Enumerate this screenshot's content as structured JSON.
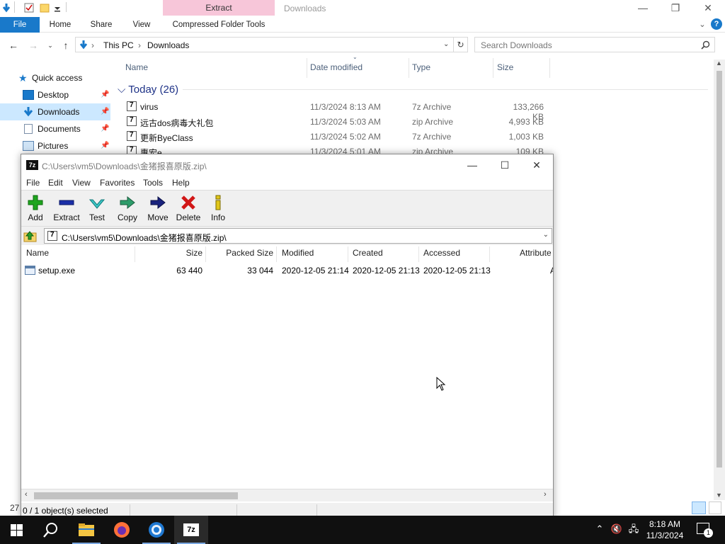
{
  "explorer": {
    "title": "Downloads",
    "context_tab": "Extract",
    "ribbon_tabs": [
      "File",
      "Home",
      "Share",
      "View",
      "Compressed Folder Tools"
    ],
    "breadcrumb": [
      "This PC",
      "Downloads"
    ],
    "search_placeholder": "Search Downloads",
    "sidebar": [
      {
        "label": "Quick access",
        "icon": "star-icon"
      },
      {
        "label": "Desktop",
        "icon": "desktop-icon"
      },
      {
        "label": "Downloads",
        "icon": "download-icon"
      },
      {
        "label": "Documents",
        "icon": "documents-icon"
      },
      {
        "label": "Pictures",
        "icon": "pictures-icon"
      }
    ],
    "columns": [
      "Name",
      "Date modified",
      "Type",
      "Size"
    ],
    "group_header": "Today (26)",
    "files": [
      {
        "name": "virus",
        "date": "11/3/2024 8:13 AM",
        "type": "7z Archive",
        "size": "133,266 KB"
      },
      {
        "name": "远古dos病毒大礼包",
        "date": "11/3/2024 5:03 AM",
        "type": "zip Archive",
        "size": "4,993 KB"
      },
      {
        "name": "更新ByeClass",
        "date": "11/3/2024 5:02 AM",
        "type": "7z Archive",
        "size": "1,003 KB"
      },
      {
        "name": "惠宏e",
        "date": "11/3/2024 5:01 AM",
        "type": "zip Archive",
        "size": "109 KB"
      }
    ],
    "status_count": "27"
  },
  "sevenzip": {
    "title": "C:\\Users\\vm5\\Downloads\\金猪报喜原版.zip\\",
    "menu": [
      "File",
      "Edit",
      "View",
      "Favorites",
      "Tools",
      "Help"
    ],
    "toolbar": [
      "Add",
      "Extract",
      "Test",
      "Copy",
      "Move",
      "Delete",
      "Info"
    ],
    "path": "C:\\Users\\vm5\\Downloads\\金猪报喜原版.zip\\",
    "columns": [
      "Name",
      "Size",
      "Packed Size",
      "Modified",
      "Created",
      "Accessed",
      "Attribute"
    ],
    "rows": [
      {
        "name": "setup.exe",
        "size": "63 440",
        "packed": "33 044",
        "modified": "2020-12-05 21:14",
        "created": "2020-12-05 21:13",
        "accessed": "2020-12-05 21:13",
        "attr": "A"
      }
    ],
    "status": "0 / 1 object(s) selected"
  },
  "taskbar": {
    "time": "8:18 AM",
    "date": "11/3/2024",
    "notification_count": "1"
  },
  "colors": {
    "accent": "#1979ca",
    "extract_tab": "#f7c6d9",
    "taskbar": "#101010",
    "selection": "#cce8ff"
  }
}
